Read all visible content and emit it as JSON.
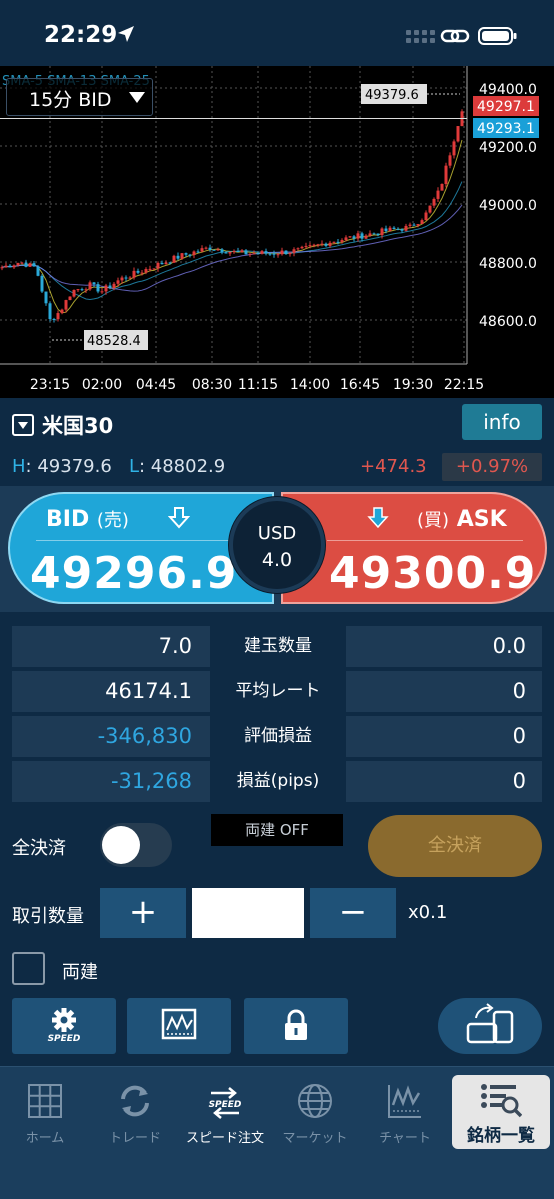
{
  "status_bar": {
    "time": "22:29"
  },
  "chart": {
    "period": "15分 BID",
    "legend": "SMA-5  SMA-13  SMA-25",
    "price_labels": [
      "49400.0",
      "49200.0",
      "49000.0",
      "48800.0",
      "48600.0"
    ],
    "time_labels": [
      "23:15",
      "02:00",
      "04:45",
      "08:30",
      "11:15",
      "14:00",
      "16:45",
      "19:30",
      "22:15"
    ],
    "high_marker": "49379.6",
    "low_marker": "48528.4",
    "ask_tag": "49297.1",
    "bid_tag": "49293.1",
    "colors": {
      "ask_tag": "#dc3b3b",
      "bid_tag": "#1aa0d8",
      "up_candle": "#e03a3a",
      "down_candle": "#2aa9d8"
    }
  },
  "symbol": {
    "name": "米国30",
    "info_label": "info",
    "high_key": "H",
    "high_value": ": 49379.6",
    "low_key": "L",
    "low_value": ": 48802.9",
    "change": "+474.3",
    "change_pct": "+0.97%"
  },
  "quote": {
    "bid_label": "BID",
    "bid_sub": "(売)",
    "bid_price": "49296.9",
    "ask_label": "ASK",
    "ask_sub": "(買)",
    "ask_price": "49300.9",
    "spread_currency": "USD",
    "spread_value": "4.0"
  },
  "positions": [
    {
      "left": "7.0",
      "label": "建玉数量",
      "right": "0.0",
      "neg": false
    },
    {
      "left": "46174.1",
      "label": "平均レート",
      "right": "0",
      "neg": false
    },
    {
      "left": "-346,830",
      "label": "評価損益",
      "right": "0",
      "neg": true
    },
    {
      "left": "-31,268",
      "label": "損益(pips)",
      "right": "0",
      "neg": true
    }
  ],
  "settle": {
    "label": "全決済",
    "hedge_badge": "両建 OFF",
    "button_label": "全決済"
  },
  "quantity": {
    "label": "取引数量",
    "plus": "+",
    "minus": "−",
    "value": "",
    "multiplier": "x0.1"
  },
  "hedge_checkbox_label": "両建",
  "tools": {
    "speed_label": "SPEED"
  },
  "tabs": [
    {
      "label": "ホーム",
      "icon": "grid-icon"
    },
    {
      "label": "トレード",
      "icon": "refresh-icon"
    },
    {
      "label": "スピード注文",
      "icon": "speed-icon"
    },
    {
      "label": "マーケット",
      "icon": "globe-icon"
    },
    {
      "label": "チャート",
      "icon": "chart-icon"
    },
    {
      "label": "銘柄一覧",
      "icon": "list-search-icon"
    }
  ]
}
